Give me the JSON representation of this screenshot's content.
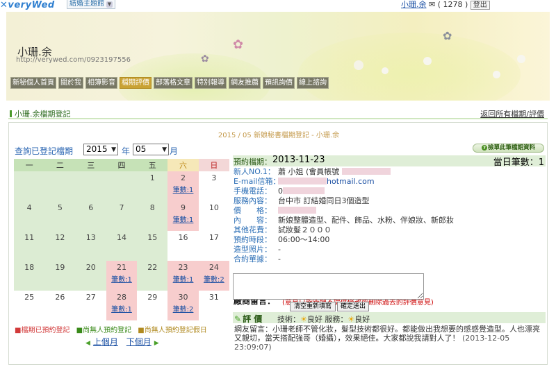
{
  "topbar": {
    "logo": "✕veryWed",
    "site_select": "結婚主題館",
    "user_name": "小珊.余",
    "mail_count": "( 1278 )",
    "logout": "登出"
  },
  "banner": {
    "title": "小珊.余",
    "url": "http://verywed.com/0923197556",
    "nav": [
      "新秘個人首頁",
      "關於我",
      "相簿影音",
      "檔期評價",
      "部落格文章",
      "特別報導",
      "網友推薦",
      "預訊詢價",
      "線上諮詢"
    ],
    "active_nav": "檔期評價"
  },
  "section": {
    "title": "小珊.余檔期登記",
    "back_link": "返回所有檔期/評價"
  },
  "panel": {
    "title": "2015 / 05 新娘秘書檔期登記 - 小珊.余",
    "query_label": "查詢已登記檔期",
    "year": "2015",
    "year_unit": "年",
    "month": "05",
    "month_unit": "月",
    "view_button": "檢單此筆檔期資料"
  },
  "calendar": {
    "weekdays": [
      "一",
      "二",
      "三",
      "四",
      "五",
      "六",
      "日"
    ],
    "booking_text": "筆數:1",
    "booking_text_2": "筆數:2",
    "days": [
      "1",
      "2",
      "3",
      "4",
      "5",
      "6",
      "7",
      "8",
      "9",
      "10",
      "11",
      "12",
      "13",
      "14",
      "15",
      "16",
      "17",
      "18",
      "19",
      "20",
      "21",
      "22",
      "23",
      "24",
      "25",
      "26",
      "27",
      "28",
      "29",
      "30",
      "31"
    ]
  },
  "legend": {
    "booked": "■檔期已預約登記",
    "free": "■尚無人預約登記",
    "free_weekend": "■尚無人預約登記假日"
  },
  "month_nav": {
    "prev": "上個月",
    "next": "下個月"
  },
  "detail": {
    "booking_label": "預約檔期：",
    "booking_date": "2013-11-23",
    "day_count": "當日筆數：1",
    "fields": [
      {
        "label": "新人NO.1：",
        "value": "蕭 小姐 (會員帳號"
      },
      {
        "label": "E-mail信箱：",
        "value": "hotmail.com"
      },
      {
        "label": "手機電話：",
        "value": "0"
      },
      {
        "label": "服務內容：",
        "value": "台中市 訂結婚同日3個造型"
      },
      {
        "label": "價　　格：",
        "value": ""
      },
      {
        "label": "內　　容：",
        "value": "新娘整體造型、配件、飾品、水粉、伴娘妝、新郎妝"
      },
      {
        "label": "其他花費：",
        "value": "試妝髮２０００"
      },
      {
        "label": "預約時段：",
        "value": "06:00～14:00"
      },
      {
        "label": "造型照片：",
        "value": "-"
      },
      {
        "label": "合約單據：",
        "value": "-"
      }
    ],
    "message_title": "廠商留言：",
    "message_note": "(意見只能新增不提供修改或刪除過去的評價意見)",
    "clear_button": "清空重新填寫",
    "submit_button": "確定送出"
  },
  "review": {
    "title": "評 價",
    "skill_label": "技術：",
    "skill_value": "良好",
    "service_label": "服務：",
    "service_value": "良好",
    "text": "網友留言：小珊老師不管化妝，髮型技術都很好。都能做出我想要的感感覺造型。人也漂亮又親切，當天搭配強哥（婚攝），效果絕佳。大家都說我請對人了！",
    "timestamp": "(2013-12-05 23:09:07)"
  },
  "colors": {
    "weekday_header": "#c6e2b7",
    "booked_cell": "#f7cdcd",
    "link": "#1a4fa3",
    "nav_active": "#c9a234"
  }
}
